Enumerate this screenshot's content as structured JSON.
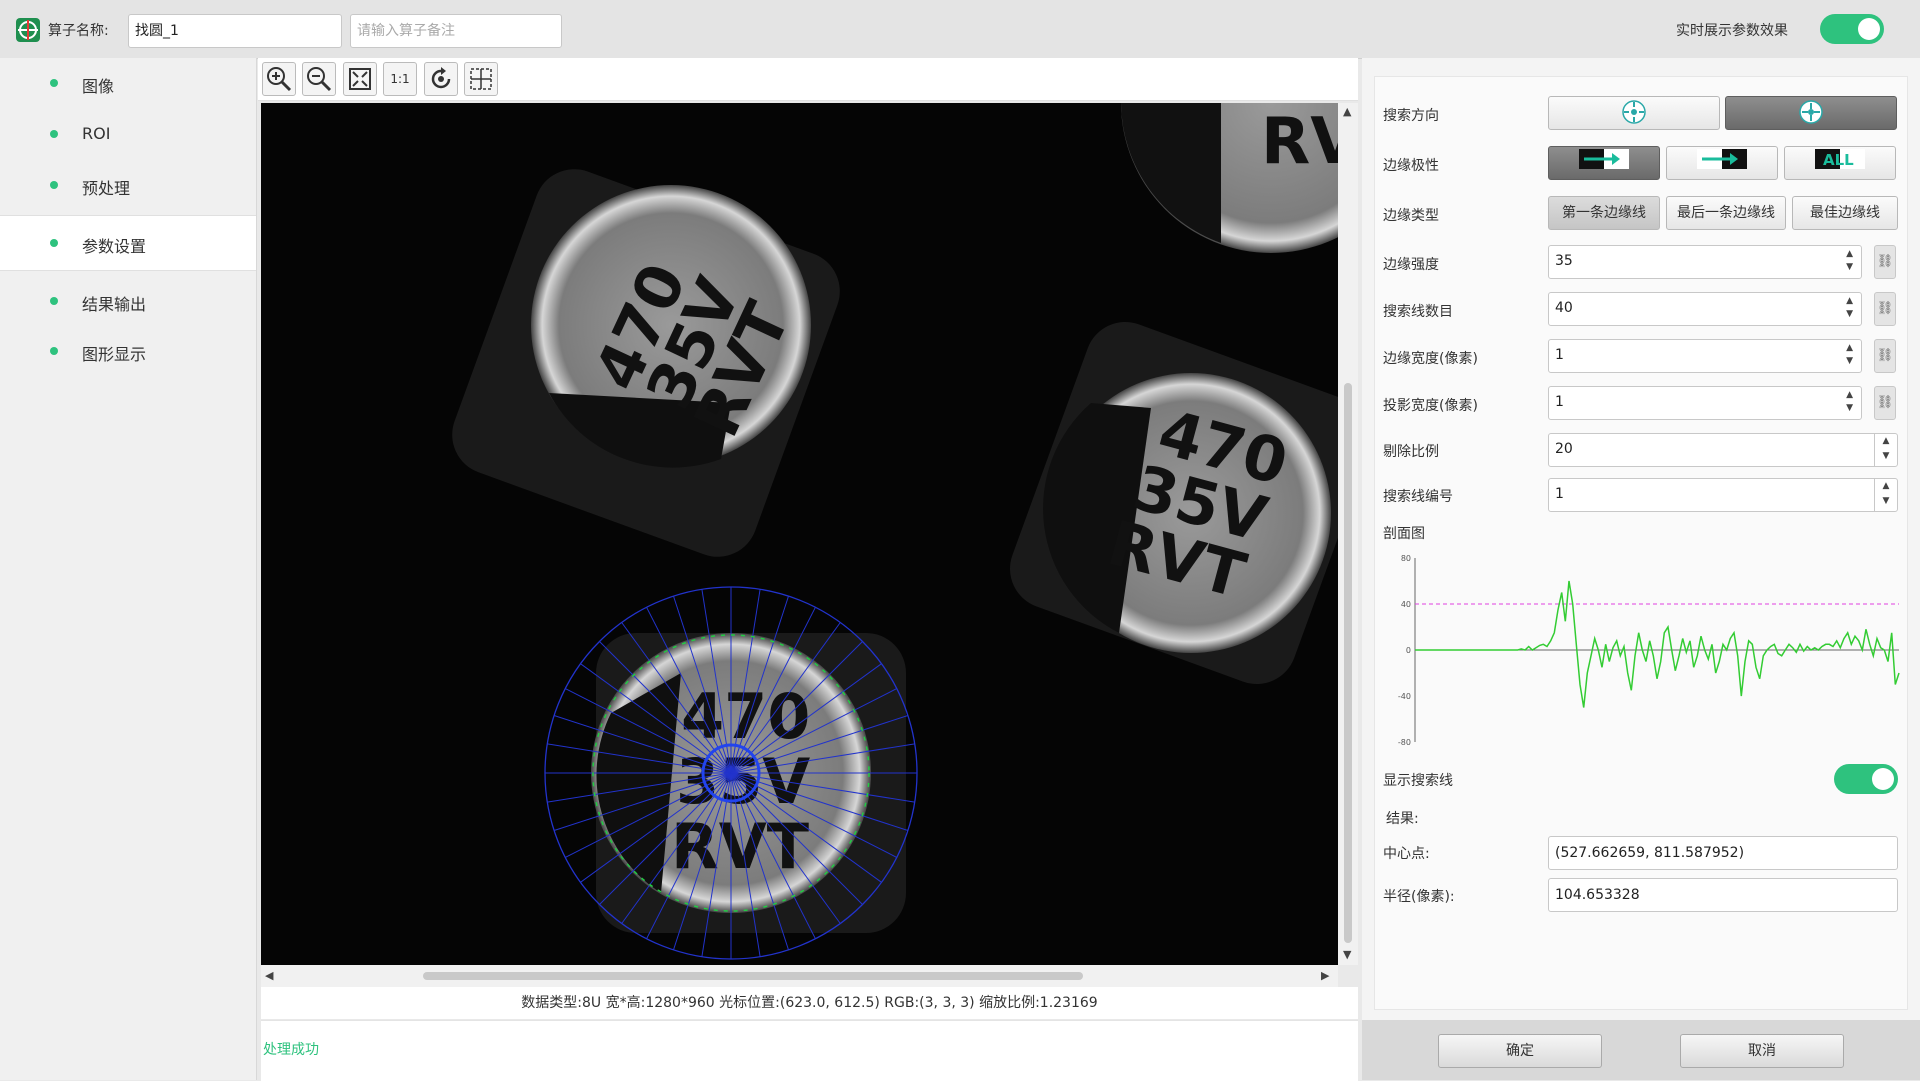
{
  "header": {
    "name_label": "算子名称:",
    "name_value": "找圆_1",
    "remark_placeholder": "请输入算子备注",
    "realtime_label": "实时展示参数效果",
    "realtime_on": true
  },
  "sidebar": {
    "items": [
      {
        "label": "图像"
      },
      {
        "label": "ROI"
      },
      {
        "label": "预处理"
      },
      {
        "label": "参数设置",
        "active": true
      },
      {
        "label": "结果输出"
      },
      {
        "label": "图形显示"
      }
    ]
  },
  "toolbar": {
    "icons": [
      "zoom-in-icon",
      "zoom-out-icon",
      "fit-screen-icon",
      "actual-size-icon",
      "rotate-icon",
      "crosshair-icon"
    ],
    "actual_size_label": "1:1"
  },
  "image": {
    "caps": [
      {
        "line1": "470",
        "line2": "35V",
        "line3": "RVT"
      },
      {
        "line1": "470",
        "line2": "35V",
        "line3": "RVT"
      },
      {
        "line1": "470",
        "line2": "35V",
        "line3": "RVT"
      },
      {
        "line1": "RVT"
      }
    ]
  },
  "status": {
    "text": "数据类型:8U 宽*高:1280*960 光标位置:(623.0, 612.5) RGB:(3, 3, 3) 缩放比例:1.23169"
  },
  "log": {
    "message": "处理成功"
  },
  "params": {
    "search_direction_label": "搜索方向",
    "edge_polarity_label": "边缘极性",
    "edge_polarity_options": [
      "dark-to-light",
      "light-to-dark",
      "ALL"
    ],
    "edge_type_label": "边缘类型",
    "edge_type_options": [
      "第一条边缘线",
      "最后一条边缘线",
      "最佳边缘线"
    ],
    "edge_strength": {
      "label": "边缘强度",
      "value": "35"
    },
    "search_line_count": {
      "label": "搜索线数目",
      "value": "40"
    },
    "edge_width": {
      "label": "边缘宽度(像素)",
      "value": "1"
    },
    "projection_width": {
      "label": "投影宽度(像素)",
      "value": "1"
    },
    "reject_ratio": {
      "label": "剔除比例",
      "value": "20"
    },
    "search_line_index": {
      "label": "搜索线编号",
      "value": "1"
    },
    "profile_label": "剖面图",
    "show_search_lines_label": "显示搜索线",
    "show_search_lines_on": true,
    "result_label": "结果:",
    "center": {
      "label": "中心点:",
      "value": "(527.662659, 811.587952)"
    },
    "radius": {
      "label": "半径(像素):",
      "value": "104.653328"
    }
  },
  "footer": {
    "ok_label": "确定",
    "cancel_label": "取消"
  },
  "chart_data": {
    "type": "line",
    "yticks": [
      "80",
      "40",
      "0",
      "-40",
      "-80"
    ],
    "ylim": [
      -80,
      80
    ],
    "threshold": 40,
    "colors": {
      "line": "#33cc33",
      "threshold": "#e040e0"
    },
    "y": [
      0,
      0,
      0,
      0,
      0,
      0,
      0,
      0,
      0,
      0,
      0,
      0,
      0,
      0,
      0,
      0,
      0,
      0,
      0,
      0,
      0,
      0,
      0,
      0,
      0,
      0,
      0,
      0,
      0,
      1,
      0,
      3,
      0,
      2,
      4,
      5,
      3,
      8,
      15,
      35,
      50,
      25,
      60,
      40,
      5,
      -30,
      -50,
      -20,
      -5,
      10,
      0,
      -15,
      5,
      -10,
      2,
      8,
      -5,
      3,
      -20,
      -35,
      -5,
      15,
      0,
      -10,
      8,
      -5,
      -25,
      -10,
      15,
      20,
      0,
      -18,
      -5,
      10,
      -2,
      8,
      -15,
      -5,
      12,
      0,
      -8,
      5,
      -20,
      -10,
      5,
      0,
      10,
      15,
      -5,
      -40,
      -10,
      8,
      5,
      -15,
      -25,
      -5,
      0,
      3,
      5,
      -3,
      -5,
      0,
      5,
      2,
      -2,
      5,
      -1,
      3,
      0,
      2,
      0,
      3,
      5,
      5,
      3,
      8,
      2,
      10,
      15,
      5,
      12,
      8,
      0,
      18,
      5,
      -5,
      10,
      2,
      0,
      -10,
      15,
      -30,
      -20
    ]
  }
}
